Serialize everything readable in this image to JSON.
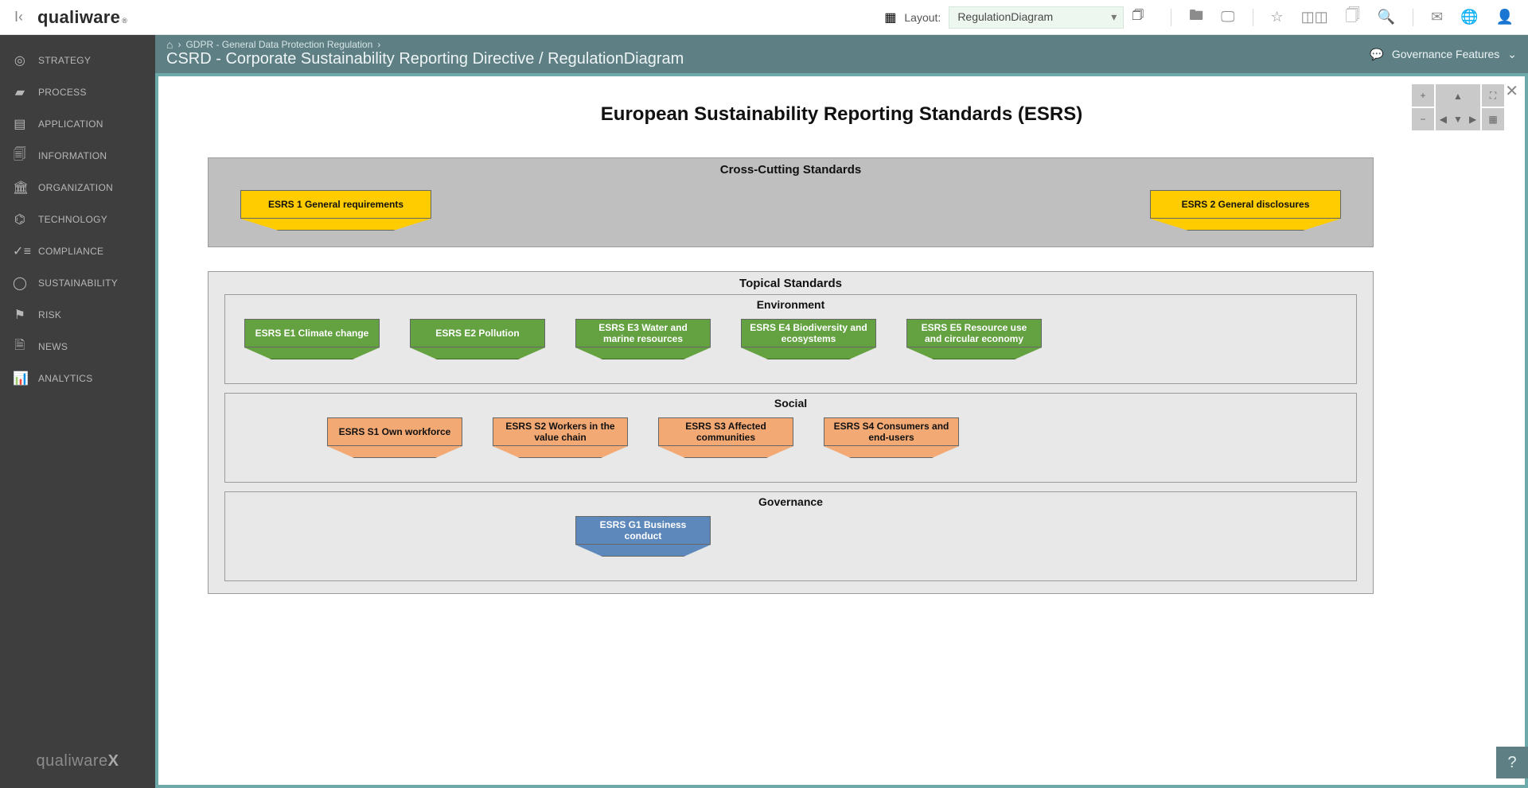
{
  "brand": {
    "top": "qualiware",
    "top_reg": "®",
    "bottom_prefix": "qualiware",
    "bottom_suffix": "X"
  },
  "topbar": {
    "layout_label": "Layout:",
    "layout_value": "RegulationDiagram"
  },
  "sidebar": {
    "items": [
      {
        "label": "STRATEGY",
        "icon": "◎"
      },
      {
        "label": "PROCESS",
        "icon": "▰"
      },
      {
        "label": "APPLICATION",
        "icon": "▤"
      },
      {
        "label": "INFORMATION",
        "icon": "🗐"
      },
      {
        "label": "ORGANIZATION",
        "icon": "🏛"
      },
      {
        "label": "TECHNOLOGY",
        "icon": "⌬"
      },
      {
        "label": "COMPLIANCE",
        "icon": "✓≡"
      },
      {
        "label": "SUSTAINABILITY",
        "icon": "◯"
      },
      {
        "label": "RISK",
        "icon": "⚑"
      },
      {
        "label": "NEWS",
        "icon": "🗎"
      },
      {
        "label": "ANALYTICS",
        "icon": "📊"
      }
    ]
  },
  "breadcrumb": {
    "parent": "GDPR - General Data Protection Regulation"
  },
  "page_title": "CSRD - Corporate Sustainability Reporting Directive / RegulationDiagram",
  "gov_features": "Governance Features",
  "diagram": {
    "title": "European Sustainability Reporting Standards (ESRS)",
    "sections": {
      "cross": {
        "title": "Cross-Cutting Standards",
        "items": [
          "ESRS 1 General requirements",
          "ESRS 2 General disclosures"
        ]
      },
      "topical": {
        "title": "Topical Standards",
        "environment": {
          "title": "Environment",
          "items": [
            "ESRS E1 Climate change",
            "ESRS E2 Pollution",
            "ESRS E3 Water and marine resources",
            "ESRS E4 Biodiversity and ecosystems",
            "ESRS E5 Resource use and circular economy"
          ]
        },
        "social": {
          "title": "Social",
          "items": [
            "ESRS S1 Own workforce",
            "ESRS S2 Workers in the value chain",
            "ESRS S3 Affected communities",
            "ESRS S4 Consumers and end-users"
          ]
        },
        "governance": {
          "title": "Governance",
          "items": [
            "ESRS G1 Business conduct"
          ]
        }
      }
    }
  }
}
